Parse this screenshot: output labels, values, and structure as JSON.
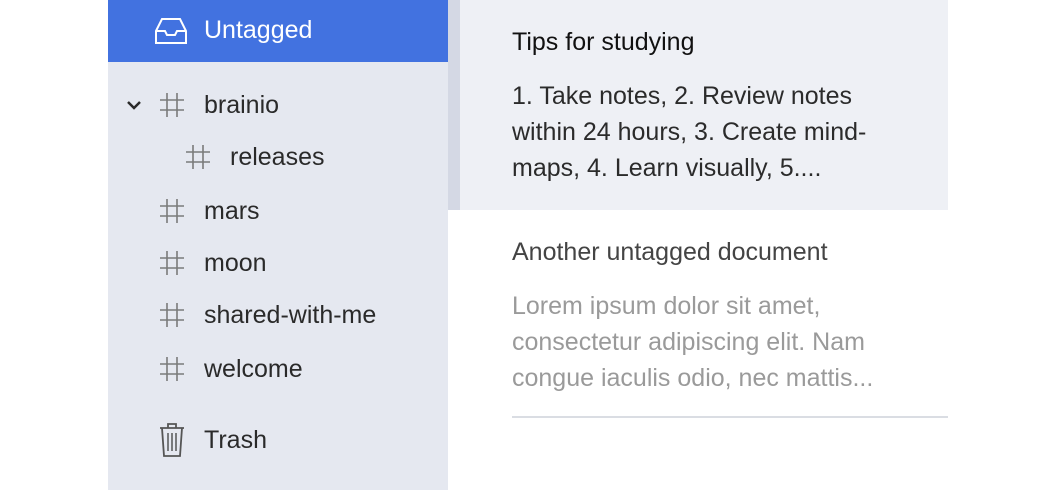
{
  "sidebar": {
    "items": [
      {
        "label": "Untagged",
        "icon": "inbox-icon"
      },
      {
        "label": "brainio",
        "icon": "hash-icon",
        "expanded": true
      },
      {
        "label": "releases",
        "icon": "hash-icon"
      },
      {
        "label": "mars",
        "icon": "hash-icon"
      },
      {
        "label": "moon",
        "icon": "hash-icon"
      },
      {
        "label": "shared-with-me",
        "icon": "hash-icon"
      },
      {
        "label": "welcome",
        "icon": "hash-icon"
      },
      {
        "label": "Trash",
        "icon": "trash-icon"
      }
    ]
  },
  "documents": [
    {
      "title": "Tips for studying",
      "preview": "1. Take notes, 2. Review notes within 24 hours, 3. Create mind-maps, 4. Learn visually, 5...."
    },
    {
      "title": "Another untagged document",
      "preview": "Lorem ipsum dolor sit amet, consectetur adipiscing elit. Nam congue iaculis odio, nec mattis..."
    }
  ],
  "colors": {
    "accent": "#4272e0",
    "sidebar_bg": "#e5e8f0",
    "selected_doc_bg": "#eef0f5"
  }
}
